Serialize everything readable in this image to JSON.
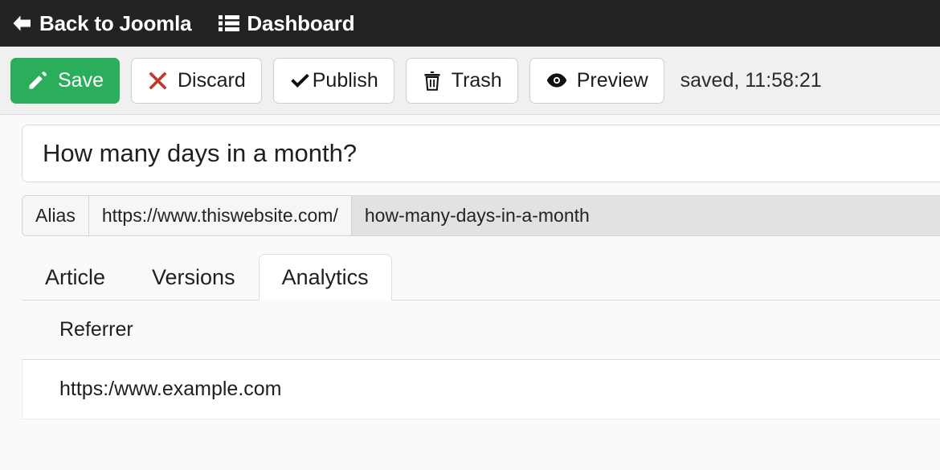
{
  "topbar": {
    "back_label": "Back to Joomla",
    "back_icon": "arrow-left-icon",
    "dashboard_label": "Dashboard",
    "dashboard_icon": "list-icon",
    "background": "#232323"
  },
  "toolbar": {
    "buttons": [
      {
        "label": "Save",
        "icon": "pencil-icon",
        "variant": "primary"
      },
      {
        "label": "Discard",
        "icon": "x-mark-icon",
        "variant": "default"
      },
      {
        "label": "Publish",
        "icon": "check-icon",
        "variant": "default"
      },
      {
        "label": "Trash",
        "icon": "trash-icon",
        "variant": "default"
      },
      {
        "label": "Preview",
        "icon": "eye-icon",
        "variant": "default"
      }
    ],
    "status": "saved, 11:58:21",
    "save_color": "#2bae5c",
    "discard_icon_color": "#c0392b"
  },
  "editor": {
    "title_value": "How many days in a month?",
    "title_placeholder": "Title",
    "alias": {
      "label": "Alias",
      "url_prefix": "https://www.thiswebsite.com/",
      "slug_value": "how-many-days-in-a-month",
      "slug_placeholder": "alias"
    },
    "tabs": [
      {
        "label": "Article",
        "active": false
      },
      {
        "label": "Versions",
        "active": false
      },
      {
        "label": "Analytics",
        "active": true
      }
    ]
  },
  "analytics": {
    "columns": [
      "Referrer"
    ],
    "rows": [
      [
        "https:/www.example.com"
      ]
    ]
  }
}
